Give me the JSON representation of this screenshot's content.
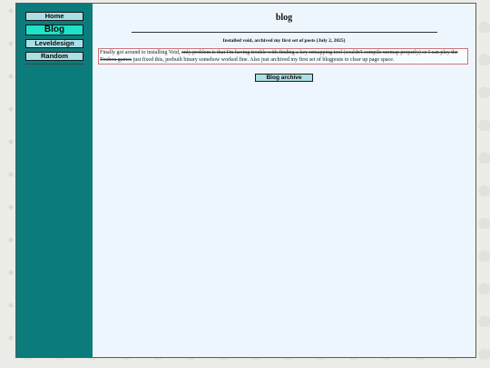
{
  "nav": {
    "home_label": "Home",
    "blog_label": "Blog",
    "leveldesign_label": "Leveldesign",
    "random_label": "Random"
  },
  "page": {
    "title": "blog"
  },
  "post": {
    "heading": "Installed void, archived my first set of posts (July 2, 2025)",
    "text_intro": "Finally got around to installing Void, ",
    "text_struck": "only problem is that I'm having trouble with finding a key remapping tool (couldn't compile xremap properly) so I can play the Touhou games",
    "text_rest": " just fixed this, prebuilt binary somehow worked fine. Also just archived my first set of blogposts to clear up page space."
  },
  "archive": {
    "button_label": "Blog archive"
  },
  "colors": {
    "sidebar": "#0b7c7b",
    "button": "#a9dfe5",
    "active_button": "#1ee2c8",
    "main_bg": "#eef6fd"
  }
}
